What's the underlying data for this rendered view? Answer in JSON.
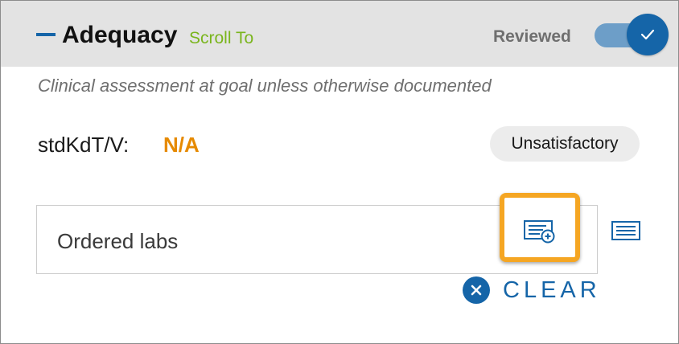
{
  "section": {
    "title": "Adequacy",
    "scroll_link": "Scroll To",
    "reviewed_label": "Reviewed",
    "reviewed_on": true,
    "subtitle": "Clinical assessment at goal unless otherwise documented"
  },
  "metric": {
    "label": "stdKdT/V:",
    "value": "N/A",
    "status": "Unsatisfactory"
  },
  "labs": {
    "placeholder": "Ordered labs",
    "clear_label": "CLEAR"
  },
  "icons": {
    "collapse": "minus-icon",
    "toggle": "check-icon",
    "add_lab": "list-add-icon",
    "list": "list-icon",
    "clear": "close-circle-icon"
  },
  "colors": {
    "primary": "#1565a8",
    "link_green": "#7ab51d",
    "value_orange": "#e68a00",
    "highlight": "#f5a623",
    "header_bg": "#e3e3e3"
  }
}
